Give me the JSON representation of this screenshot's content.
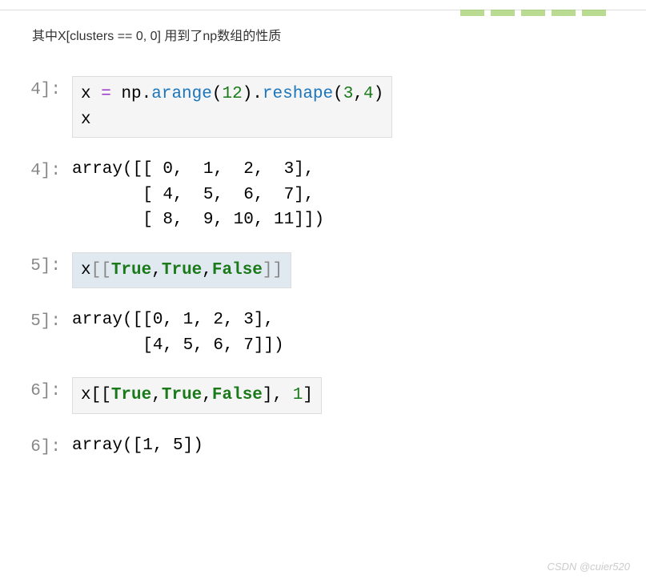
{
  "intro": "其中X[clusters == 0, 0] 用到了np数组的性质",
  "cells": {
    "c4_num": "4]:",
    "c4_code_line1_var": "x ",
    "c4_code_line1_op": "= ",
    "c4_code_line1_mod": "np.",
    "c4_code_line1_func1": "arange",
    "c4_code_line1_paren1": "(",
    "c4_code_line1_arg1": "12",
    "c4_code_line1_paren2": ").",
    "c4_code_line1_func2": "reshape",
    "c4_code_line1_paren3": "(",
    "c4_code_line1_arg2": "3",
    "c4_code_line1_comma": ",",
    "c4_code_line1_arg3": "4",
    "c4_code_line1_paren4": ")",
    "c4_code_line2": "x",
    "c4_out_num": "4]:",
    "c4_out": "array([[ 0,  1,  2,  3],\n       [ 4,  5,  6,  7],\n       [ 8,  9, 10, 11]])",
    "c5_num": "5]:",
    "c5_code_var": "x",
    "c5_code_b1": "[[",
    "c5_code_v1": "True",
    "c5_code_c1": ",",
    "c5_code_v2": "True",
    "c5_code_c2": ",",
    "c5_code_v3": "False",
    "c5_code_b2": "]]",
    "c5_out_num": "5]:",
    "c5_out": "array([[0, 1, 2, 3],\n       [4, 5, 6, 7]])",
    "c6_num": "6]:",
    "c6_code_var": "x",
    "c6_code_b1": "[",
    "c6_code_b2": "[",
    "c6_code_v1": "True",
    "c6_code_c1": ",",
    "c6_code_v2": "True",
    "c6_code_c2": ",",
    "c6_code_v3": "False",
    "c6_code_b3": "]",
    "c6_code_c3": ", ",
    "c6_code_idx": "1",
    "c6_code_b4": "]",
    "c6_out_num": "6]:",
    "c6_out": "array([1, 5])"
  },
  "watermark": "CSDN @cuier520",
  "chart_data": {
    "type": "table",
    "title": "NumPy boolean indexing examples",
    "cells": [
      {
        "in": "x = np.arange(12).reshape(3,4)\nx",
        "out": "array([[ 0,  1,  2,  3],\n       [ 4,  5,  6,  7],\n       [ 8,  9, 10, 11]])",
        "exec_count": 4
      },
      {
        "in": "x[[True,True,False]]",
        "out": "array([[0, 1, 2, 3],\n       [4, 5, 6, 7]])",
        "exec_count": 5
      },
      {
        "in": "x[[True,True,False], 1]",
        "out": "array([1, 5])",
        "exec_count": 6
      }
    ]
  }
}
